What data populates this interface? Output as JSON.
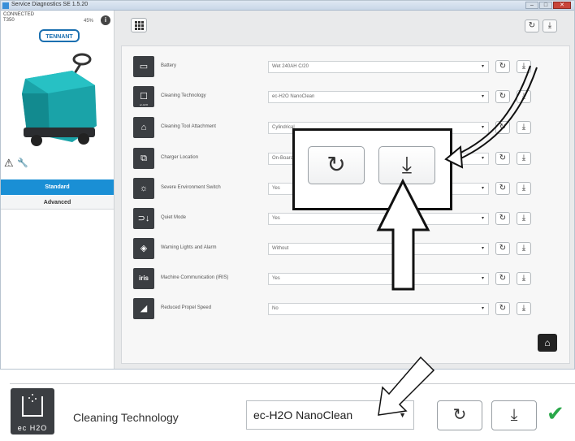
{
  "window": {
    "title": "Service Diagnostics SE 1.5.20",
    "min": "–",
    "max": "□",
    "close": "✕"
  },
  "left_panel": {
    "status": "CONNECTED",
    "model": "T350",
    "battery": "45%",
    "info_icon": "i",
    "logo_text": "TENNANT",
    "tabs": [
      "Standard",
      "Advanced"
    ]
  },
  "toolbar": {
    "grid_icon": "grid-icon",
    "refresh": "↻",
    "download": "⤓"
  },
  "rows": [
    {
      "icon": "battery-icon",
      "glyph": "▭",
      "label": "Battery",
      "value": "Wet 240AH C/20"
    },
    {
      "icon": "cleaning-tech-icon",
      "glyph": "☐",
      "sub": "ec-H2O",
      "label": "Cleaning Technology",
      "value": "ec-H2O NanoClean"
    },
    {
      "icon": "tool-attachment-icon",
      "glyph": "⌂",
      "label": "Cleaning Tool Attachment",
      "value": "Cylindrical"
    },
    {
      "icon": "charger-icon",
      "glyph": "⧉",
      "label": "Charger Location",
      "value": "On-Board"
    },
    {
      "icon": "severe-env-icon",
      "glyph": "☼",
      "label": "Severe Environment Switch",
      "value": "Yes"
    },
    {
      "icon": "quiet-mode-icon",
      "glyph": "⊃↓",
      "label": "Quiet Mode",
      "value": "Yes"
    },
    {
      "icon": "warning-lights-icon",
      "glyph": "◈",
      "label": "Warning Lights and Alarm",
      "value": "Without"
    },
    {
      "icon": "iris-icon",
      "glyph": "iris",
      "label": "Machine Communication (IRIS)",
      "value": "Yes"
    },
    {
      "icon": "reduced-speed-icon",
      "glyph": "◢",
      "label": "Reduced Propel Speed",
      "value": "No"
    }
  ],
  "home_glyph": "⌂",
  "detail": {
    "icon_text": "ec H2O",
    "label": "Cleaning Technology",
    "value": "ec-H2O NanoClean",
    "dropdown_arrow": "▼",
    "refresh": "↻",
    "download": "⤓",
    "check": "✔"
  },
  "colors": {
    "accent_blue": "#1a8fd5",
    "check_green": "#2aa84a",
    "icon_bg": "#3b3e42"
  }
}
